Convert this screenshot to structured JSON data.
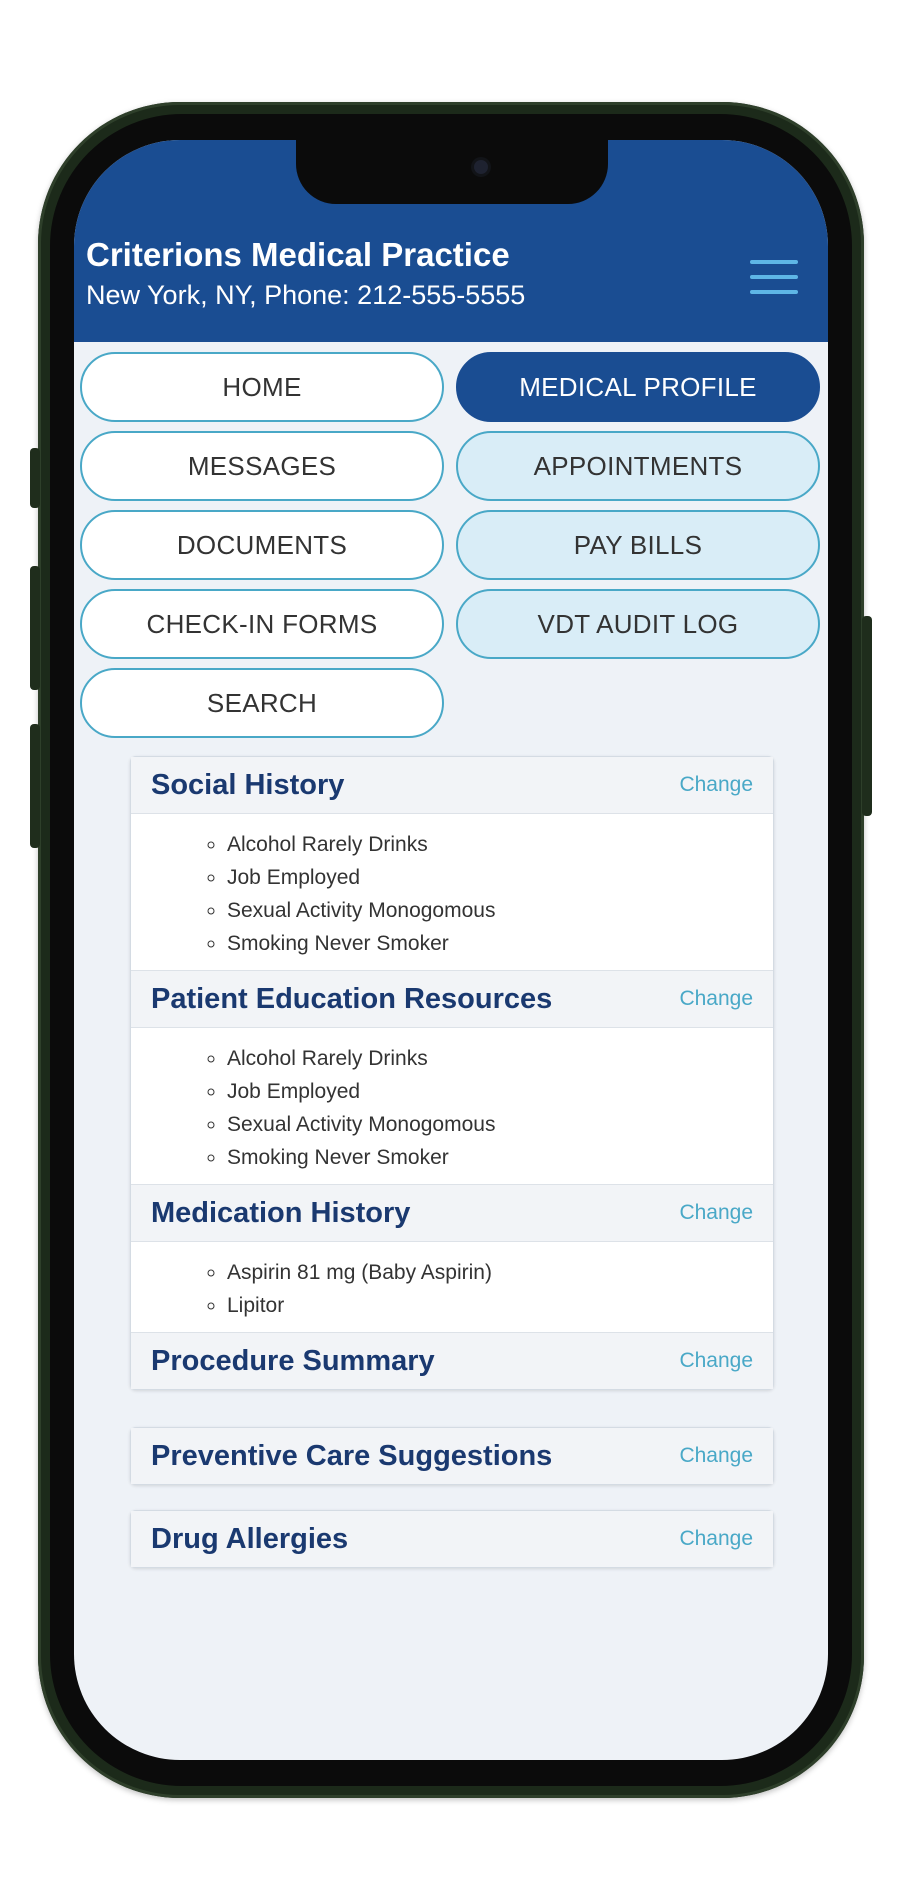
{
  "header": {
    "title": "Criterions Medical Practice",
    "subtitle": "New York, NY, Phone: 212-555-5555",
    "menu_icon": "hamburger-menu-icon"
  },
  "nav": [
    {
      "label": "HOME",
      "active": false
    },
    {
      "label": "MEDICAL PROFILE",
      "active": true
    },
    {
      "label": "MESSAGES",
      "active": false
    },
    {
      "label": "APPOINTMENTS",
      "active": false
    },
    {
      "label": "DOCUMENTS",
      "active": false
    },
    {
      "label": "PAY BILLS",
      "active": false
    },
    {
      "label": "CHECK-IN FORMS",
      "active": false
    },
    {
      "label": "VDT AUDIT LOG",
      "active": false
    },
    {
      "label": "SEARCH",
      "active": false
    }
  ],
  "sections": [
    {
      "title": "Social History",
      "change": "Change",
      "items": [
        "Alcohol Rarely Drinks",
        "Job Employed",
        "Sexual Activity Monogomous",
        "Smoking Never Smoker"
      ]
    },
    {
      "title": "Patient Education Resources",
      "change": "Change",
      "items": [
        "Alcohol Rarely Drinks",
        "Job Employed",
        "Sexual Activity Monogomous",
        "Smoking Never Smoker"
      ]
    },
    {
      "title": "Medication History",
      "change": "Change",
      "items": [
        "Aspirin 81 mg (Baby Aspirin)",
        "Lipitor"
      ]
    },
    {
      "title": "Procedure Summary",
      "change": "Change",
      "items": []
    }
  ],
  "cards": [
    {
      "title": "Preventive Care Suggestions",
      "change": "Change"
    },
    {
      "title": "Drug Allergies",
      "change": "Change"
    }
  ],
  "colors": {
    "header_bg": "#1a4d92",
    "accent": "#49a8c7",
    "title_text": "#1a3970"
  }
}
